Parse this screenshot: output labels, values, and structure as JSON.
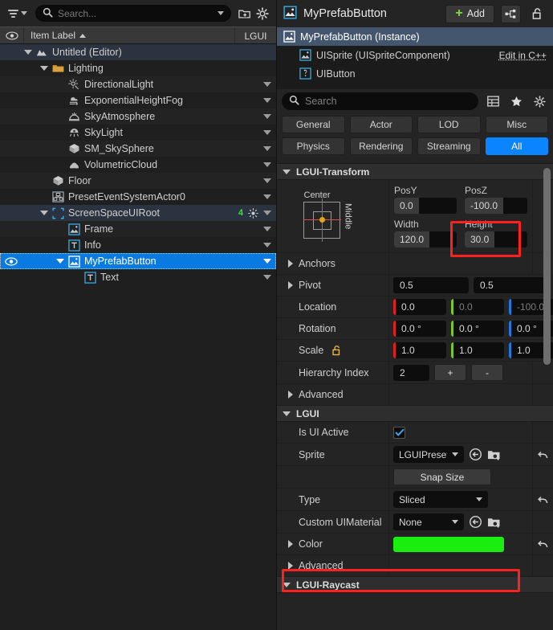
{
  "outliner": {
    "search_placeholder": "Search...",
    "header": {
      "eye_icon": "eye-icon",
      "label": "Item Label",
      "right_col": "LGUI"
    },
    "toolbar": {
      "filter_icon": "filter-icon",
      "new_folder_icon": "new-folder-icon",
      "settings_icon": "gear-icon"
    },
    "items": [
      {
        "label": "Untitled (Editor)",
        "indent": 1,
        "icon": "level-icon",
        "twisty": "open",
        "state": "light",
        "eye": false,
        "arrow": false
      },
      {
        "label": "Lighting",
        "indent": 2,
        "icon": "folder-icon",
        "twisty": "open",
        "state": "normal",
        "eye": false,
        "arrow": false
      },
      {
        "label": "DirectionalLight",
        "indent": 3,
        "icon": "sun-icon",
        "twisty": "none",
        "state": "alt",
        "eye": false,
        "arrow": true
      },
      {
        "label": "ExponentialHeightFog",
        "indent": 3,
        "icon": "fog-icon",
        "twisty": "none",
        "state": "normal",
        "eye": false,
        "arrow": true
      },
      {
        "label": "SkyAtmosphere",
        "indent": 3,
        "icon": "atmosphere-icon",
        "twisty": "none",
        "state": "alt",
        "eye": false,
        "arrow": true
      },
      {
        "label": "SkyLight",
        "indent": 3,
        "icon": "skylight-icon",
        "twisty": "none",
        "state": "normal",
        "eye": false,
        "arrow": true
      },
      {
        "label": "SM_SkySphere",
        "indent": 3,
        "icon": "mesh-icon",
        "twisty": "none",
        "state": "alt",
        "eye": false,
        "arrow": true
      },
      {
        "label": "VolumetricCloud",
        "indent": 3,
        "icon": "cloud-icon",
        "twisty": "none",
        "state": "normal",
        "eye": false,
        "arrow": true
      },
      {
        "label": "Floor",
        "indent": 2,
        "icon": "mesh-icon",
        "twisty": "none",
        "state": "alt",
        "eye": false,
        "arrow": true
      },
      {
        "label": "PresetEventSystemActor0",
        "indent": 2,
        "icon": "actor-icon",
        "twisty": "none",
        "state": "normal",
        "eye": false,
        "arrow": true
      },
      {
        "label": "ScreenSpaceUIRoot",
        "indent": 2,
        "icon": "uiroot-icon",
        "twisty": "open",
        "state": "light",
        "eye": false,
        "arrow": true,
        "badge": "4",
        "badge_icon": "light-icon"
      },
      {
        "label": "Frame",
        "indent": 3,
        "icon": "sprite-icon",
        "twisty": "none",
        "state": "alt",
        "eye": false,
        "arrow": true
      },
      {
        "label": "Info",
        "indent": 3,
        "icon": "text-icon",
        "twisty": "none",
        "state": "normal",
        "eye": false,
        "arrow": true
      },
      {
        "label": "MyPrefabButton",
        "indent": 3,
        "icon": "sprite-icon",
        "twisty": "open",
        "state": "selected",
        "eye": true,
        "arrow": true
      },
      {
        "label": "Text",
        "indent": 4,
        "icon": "text-icon",
        "twisty": "none",
        "state": "normal",
        "eye": false,
        "arrow": true
      }
    ]
  },
  "details": {
    "title": "MyPrefabButton",
    "title_icon": "sprite-icon",
    "add_label": "Add",
    "blueprint_icon": "blueprint-icon",
    "lock_icon": "unlock-icon",
    "components": [
      {
        "label": "MyPrefabButton (Instance)",
        "icon": "sprite-icon",
        "selected": true,
        "indent": false,
        "link": ""
      },
      {
        "label": "UISprite (UISpriteComponent)",
        "icon": "sprite-icon",
        "selected": false,
        "indent": true,
        "link": "Edit in C++"
      },
      {
        "label": "UIButton",
        "icon": "button-icon",
        "selected": false,
        "indent": true,
        "link": ""
      }
    ],
    "search_placeholder": "Search",
    "search_icons": [
      "columns-icon",
      "star-icon",
      "gear-icon"
    ],
    "categories_row1": [
      {
        "label": "General",
        "active": false
      },
      {
        "label": "Actor",
        "active": false
      },
      {
        "label": "LOD",
        "active": false
      },
      {
        "label": "Misc",
        "active": false
      }
    ],
    "categories_row2": [
      {
        "label": "Physics",
        "active": false
      },
      {
        "label": "Rendering",
        "active": false
      },
      {
        "label": "Streaming",
        "active": false
      },
      {
        "label": "All",
        "active": true
      }
    ],
    "section_transform": "LGUI-Transform",
    "transform": {
      "anchor_top_label": "Center",
      "anchor_side_label": "Middle",
      "posy_label": "PosY",
      "posy_value": "0.0",
      "posz_label": "PosZ",
      "posz_value": "-100.0",
      "width_label": "Width",
      "width_value": "120.0",
      "height_label": "Height",
      "height_value": "30.0"
    },
    "rows": [
      {
        "label": "Anchors",
        "type": "expandable"
      },
      {
        "label": "Pivot",
        "type": "pivot",
        "values": [
          "0.5",
          "0.5"
        ]
      },
      {
        "label": "Location",
        "type": "vector",
        "values": [
          "0.0",
          "0.0",
          "-100.0"
        ],
        "dim": [
          false,
          true,
          true
        ]
      },
      {
        "label": "Rotation",
        "type": "vector",
        "values": [
          "0.0 °",
          "0.0 °",
          "0.0 °"
        ],
        "dim": [
          false,
          false,
          false
        ]
      },
      {
        "label": "Scale",
        "type": "vector",
        "values": [
          "1.0",
          "1.0",
          "1.0"
        ],
        "dim": [
          false,
          false,
          false
        ],
        "icon": "unlock-icon"
      },
      {
        "label": "Hierarchy Index",
        "type": "index",
        "value": "2",
        "plus": "+",
        "minus": "-"
      },
      {
        "label": "Advanced",
        "type": "expandable"
      }
    ],
    "section_lgui": "LGUI",
    "lgui_rows": [
      {
        "label": "Is UI Active",
        "type": "checkbox",
        "checked": true
      },
      {
        "label": "Sprite",
        "type": "asset",
        "value": "LGUIPreset_",
        "icons": [
          "browse-back-icon",
          "find-asset-icon"
        ],
        "revert": true
      },
      {
        "label": "",
        "type": "button",
        "value": "Snap Size"
      },
      {
        "label": "Type",
        "type": "combo",
        "value": "Sliced",
        "revert": true
      },
      {
        "label": "Custom UIMaterial",
        "type": "asset",
        "value": "None",
        "icons": [
          "browse-back-icon",
          "find-asset-icon"
        ],
        "revert": false
      },
      {
        "label": "Color",
        "type": "color",
        "value": "#19EE0E",
        "expandable": true,
        "revert": true
      },
      {
        "label": "Advanced",
        "type": "expandable"
      }
    ],
    "section_raycast": "LGUI-Raycast"
  },
  "highlights": {
    "accent_red": "#FF2020",
    "accent_blue": "#0A84FF",
    "accent_green": "#19EE0E"
  }
}
